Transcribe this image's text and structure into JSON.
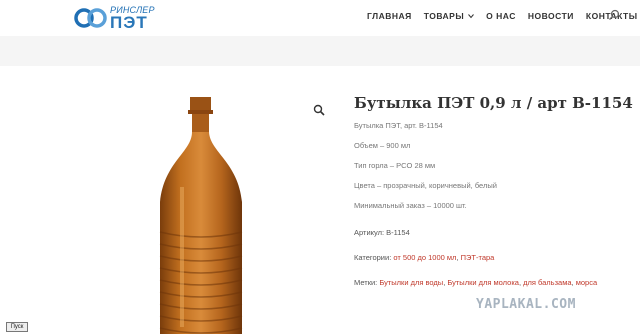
{
  "logo": {
    "top_text": "РИНСЛЕР",
    "main_text": "ПЭТ",
    "icon": "infinity-logo-icon"
  },
  "nav": {
    "items": [
      "ГЛАВНАЯ",
      "ТОВАРЫ",
      "О НАС",
      "НОВОСТИ",
      "КОНТАКТЫ"
    ],
    "search_icon": "search-icon"
  },
  "product": {
    "title": "Бутылка ПЭТ 0,9 л / арт В-1154",
    "description": [
      "Бутылка ПЭТ, арт. В-1154",
      "Объем – 900 мл",
      "Тип горла – PCO 28 мм",
      "Цвета – прозрачный, коричневый, белый",
      "Минимальный заказ – 10000 шт."
    ],
    "sku_label": "Артикул:",
    "sku_value": "В-1154",
    "categories_label": "Категории:",
    "categories": [
      "от 500 до 1000 мл",
      "ПЭТ-тара"
    ],
    "tags_label": "Метки:",
    "tags": [
      "Бутылки для воды",
      "Бутылки для молока",
      "для бальзама",
      "морса"
    ],
    "zoom_icon": "zoom-icon"
  },
  "watermark": "YAPLAKAL.COM",
  "start_button": "Пуск",
  "colors": {
    "accent": "#2a77b8",
    "link": "#c0392b",
    "bottle": "#b5651d"
  }
}
